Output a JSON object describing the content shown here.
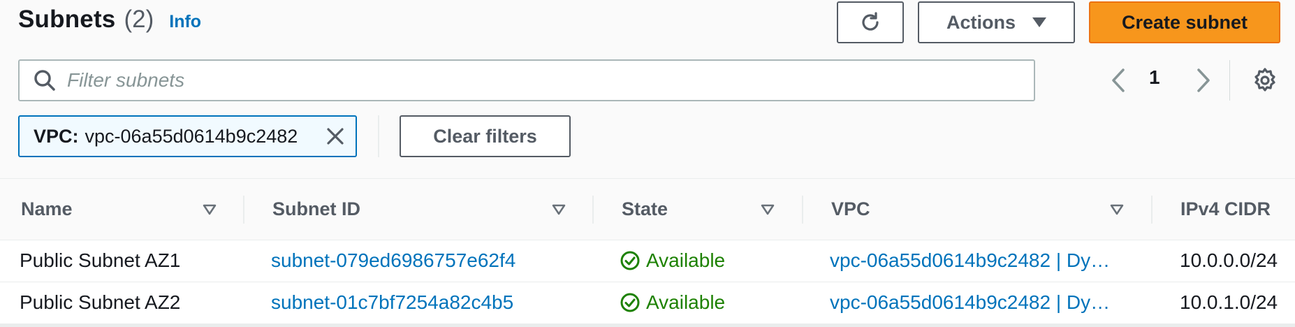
{
  "header": {
    "title": "Subnets",
    "count": "(2)",
    "info_label": "Info",
    "actions_label": "Actions",
    "create_label": "Create subnet"
  },
  "search": {
    "placeholder": "Filter subnets",
    "value": ""
  },
  "pagination": {
    "current_page": "1"
  },
  "filter_token": {
    "key": "VPC:",
    "value": "vpc-06a55d0614b9c2482"
  },
  "clear_filters_label": "Clear filters",
  "table": {
    "columns": [
      "Name",
      "Subnet ID",
      "State",
      "VPC",
      "IPv4 CIDR"
    ],
    "rows": [
      {
        "name": "Public Subnet AZ1",
        "subnet_id": "subnet-079ed6986757e62f4",
        "state": "Available",
        "vpc": "vpc-06a55d0614b9c2482 | Dy…",
        "cidr": "10.0.0.0/24"
      },
      {
        "name": "Public Subnet AZ2",
        "subnet_id": "subnet-01c7bf7254a82c4b5",
        "state": "Available",
        "vpc": "vpc-06a55d0614b9c2482 | Dy…",
        "cidr": "10.0.1.0/24"
      }
    ]
  },
  "colors": {
    "link": "#0073bb",
    "primary_button": "#f7961c",
    "success": "#1d8102",
    "token_bg": "#f1faff"
  },
  "icons": {
    "refresh": "refresh-icon",
    "caret": "caret-down-icon",
    "search": "search-icon",
    "prev": "chevron-left-icon",
    "next": "chevron-right-icon",
    "settings": "gear-icon",
    "close": "close-icon",
    "sort": "sort-triangle-icon",
    "status": "check-circle-icon"
  }
}
